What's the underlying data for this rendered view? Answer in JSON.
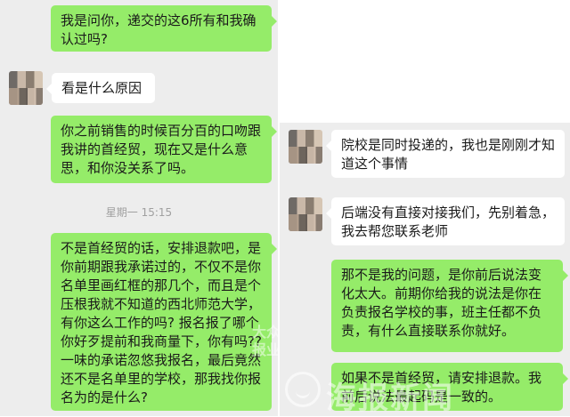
{
  "chat_left": {
    "messages": [
      {
        "text": "我是问你，递交的这6所有和我确认过吗?"
      },
      {
        "text": "看是什么原因"
      },
      {
        "text": "你之前销售的时候百分百的口吻跟我讲的首经贸，现在又是什么意思，和你没关系了吗。"
      },
      {
        "text": "不是首经贸的话，安排退款吧，是你前期跟我承诺过的，不仅不是你名单里画红框的那几个，而且是个压根我就不知道的西北师范大学，有你这么工作的吗? 报名报了哪个你好歹提前和我商量下，你有吗??\n一味的承诺忽悠我报名，最后竟然还不是名单里的学校，那我找你报名为的是什么?"
      }
    ],
    "timestamp": "星期一 15:15"
  },
  "chat_right": {
    "messages": [
      {
        "text": "院校是同时投递的，我也是刚刚才知道这个事情"
      },
      {
        "text": "后端没有直接对接我们，先别着急，我去帮您联系老师"
      },
      {
        "text": "那不是我的问题，是你前后说法变化太大。前期你给我的说法是你在负责报名学校的事，班主任都不负责，有什么直接联系你就好。"
      },
      {
        "text": "如果不是首经贸，请安排退款。我前后说法最起码是一致的。"
      }
    ]
  },
  "watermark": {
    "left_text": "大众\n报业",
    "right_text": "海报新闻"
  }
}
